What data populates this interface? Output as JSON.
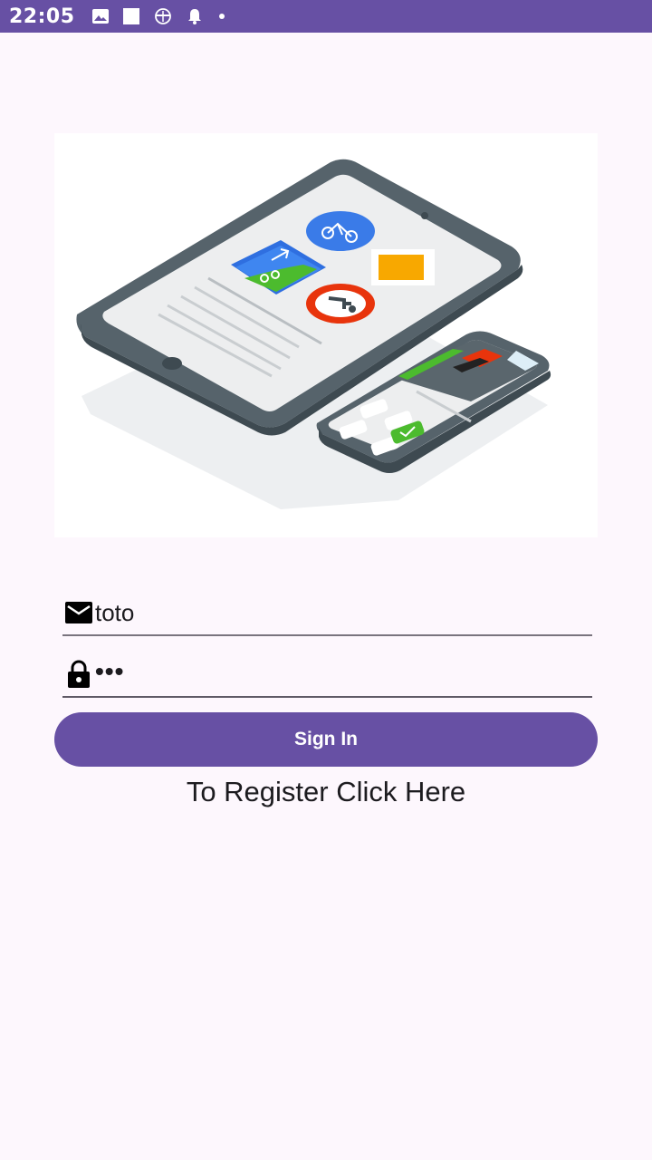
{
  "status_bar": {
    "time": "22:05",
    "icons": [
      "image-icon",
      "square-icon",
      "helicopter-icon",
      "bell-icon",
      "dot-icon"
    ],
    "background": "#6750A4"
  },
  "login": {
    "email_icon": "mail-icon",
    "email_value": "toto",
    "password_icon": "lock-icon",
    "password_value": "•••",
    "sign_in_label": "Sign In",
    "register_label": "To Register Click Here"
  },
  "colors": {
    "accent": "#6750A4",
    "background": "#FDF7FD"
  }
}
